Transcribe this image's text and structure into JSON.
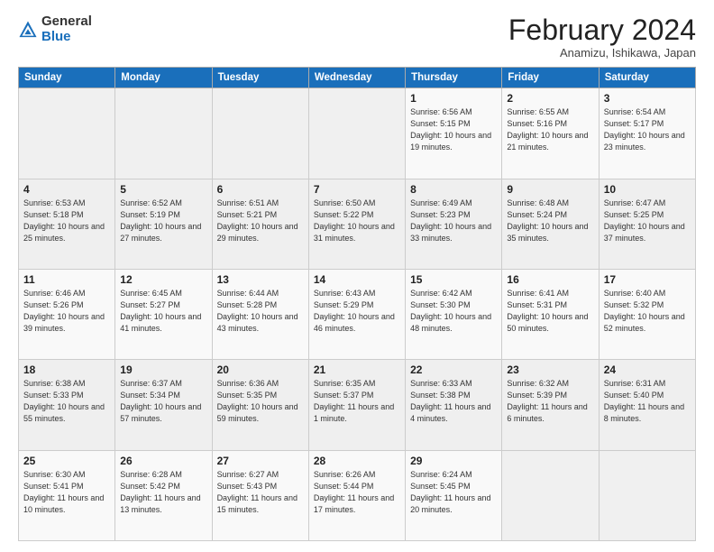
{
  "logo": {
    "general": "General",
    "blue": "Blue"
  },
  "header": {
    "month_year": "February 2024",
    "location": "Anamizu, Ishikawa, Japan"
  },
  "days_of_week": [
    "Sunday",
    "Monday",
    "Tuesday",
    "Wednesday",
    "Thursday",
    "Friday",
    "Saturday"
  ],
  "weeks": [
    [
      {
        "day": "",
        "info": ""
      },
      {
        "day": "",
        "info": ""
      },
      {
        "day": "",
        "info": ""
      },
      {
        "day": "",
        "info": ""
      },
      {
        "day": "1",
        "info": "Sunrise: 6:56 AM\nSunset: 5:15 PM\nDaylight: 10 hours and 19 minutes."
      },
      {
        "day": "2",
        "info": "Sunrise: 6:55 AM\nSunset: 5:16 PM\nDaylight: 10 hours and 21 minutes."
      },
      {
        "day": "3",
        "info": "Sunrise: 6:54 AM\nSunset: 5:17 PM\nDaylight: 10 hours and 23 minutes."
      }
    ],
    [
      {
        "day": "4",
        "info": "Sunrise: 6:53 AM\nSunset: 5:18 PM\nDaylight: 10 hours and 25 minutes."
      },
      {
        "day": "5",
        "info": "Sunrise: 6:52 AM\nSunset: 5:19 PM\nDaylight: 10 hours and 27 minutes."
      },
      {
        "day": "6",
        "info": "Sunrise: 6:51 AM\nSunset: 5:21 PM\nDaylight: 10 hours and 29 minutes."
      },
      {
        "day": "7",
        "info": "Sunrise: 6:50 AM\nSunset: 5:22 PM\nDaylight: 10 hours and 31 minutes."
      },
      {
        "day": "8",
        "info": "Sunrise: 6:49 AM\nSunset: 5:23 PM\nDaylight: 10 hours and 33 minutes."
      },
      {
        "day": "9",
        "info": "Sunrise: 6:48 AM\nSunset: 5:24 PM\nDaylight: 10 hours and 35 minutes."
      },
      {
        "day": "10",
        "info": "Sunrise: 6:47 AM\nSunset: 5:25 PM\nDaylight: 10 hours and 37 minutes."
      }
    ],
    [
      {
        "day": "11",
        "info": "Sunrise: 6:46 AM\nSunset: 5:26 PM\nDaylight: 10 hours and 39 minutes."
      },
      {
        "day": "12",
        "info": "Sunrise: 6:45 AM\nSunset: 5:27 PM\nDaylight: 10 hours and 41 minutes."
      },
      {
        "day": "13",
        "info": "Sunrise: 6:44 AM\nSunset: 5:28 PM\nDaylight: 10 hours and 43 minutes."
      },
      {
        "day": "14",
        "info": "Sunrise: 6:43 AM\nSunset: 5:29 PM\nDaylight: 10 hours and 46 minutes."
      },
      {
        "day": "15",
        "info": "Sunrise: 6:42 AM\nSunset: 5:30 PM\nDaylight: 10 hours and 48 minutes."
      },
      {
        "day": "16",
        "info": "Sunrise: 6:41 AM\nSunset: 5:31 PM\nDaylight: 10 hours and 50 minutes."
      },
      {
        "day": "17",
        "info": "Sunrise: 6:40 AM\nSunset: 5:32 PM\nDaylight: 10 hours and 52 minutes."
      }
    ],
    [
      {
        "day": "18",
        "info": "Sunrise: 6:38 AM\nSunset: 5:33 PM\nDaylight: 10 hours and 55 minutes."
      },
      {
        "day": "19",
        "info": "Sunrise: 6:37 AM\nSunset: 5:34 PM\nDaylight: 10 hours and 57 minutes."
      },
      {
        "day": "20",
        "info": "Sunrise: 6:36 AM\nSunset: 5:35 PM\nDaylight: 10 hours and 59 minutes."
      },
      {
        "day": "21",
        "info": "Sunrise: 6:35 AM\nSunset: 5:37 PM\nDaylight: 11 hours and 1 minute."
      },
      {
        "day": "22",
        "info": "Sunrise: 6:33 AM\nSunset: 5:38 PM\nDaylight: 11 hours and 4 minutes."
      },
      {
        "day": "23",
        "info": "Sunrise: 6:32 AM\nSunset: 5:39 PM\nDaylight: 11 hours and 6 minutes."
      },
      {
        "day": "24",
        "info": "Sunrise: 6:31 AM\nSunset: 5:40 PM\nDaylight: 11 hours and 8 minutes."
      }
    ],
    [
      {
        "day": "25",
        "info": "Sunrise: 6:30 AM\nSunset: 5:41 PM\nDaylight: 11 hours and 10 minutes."
      },
      {
        "day": "26",
        "info": "Sunrise: 6:28 AM\nSunset: 5:42 PM\nDaylight: 11 hours and 13 minutes."
      },
      {
        "day": "27",
        "info": "Sunrise: 6:27 AM\nSunset: 5:43 PM\nDaylight: 11 hours and 15 minutes."
      },
      {
        "day": "28",
        "info": "Sunrise: 6:26 AM\nSunset: 5:44 PM\nDaylight: 11 hours and 17 minutes."
      },
      {
        "day": "29",
        "info": "Sunrise: 6:24 AM\nSunset: 5:45 PM\nDaylight: 11 hours and 20 minutes."
      },
      {
        "day": "",
        "info": ""
      },
      {
        "day": "",
        "info": ""
      }
    ]
  ]
}
